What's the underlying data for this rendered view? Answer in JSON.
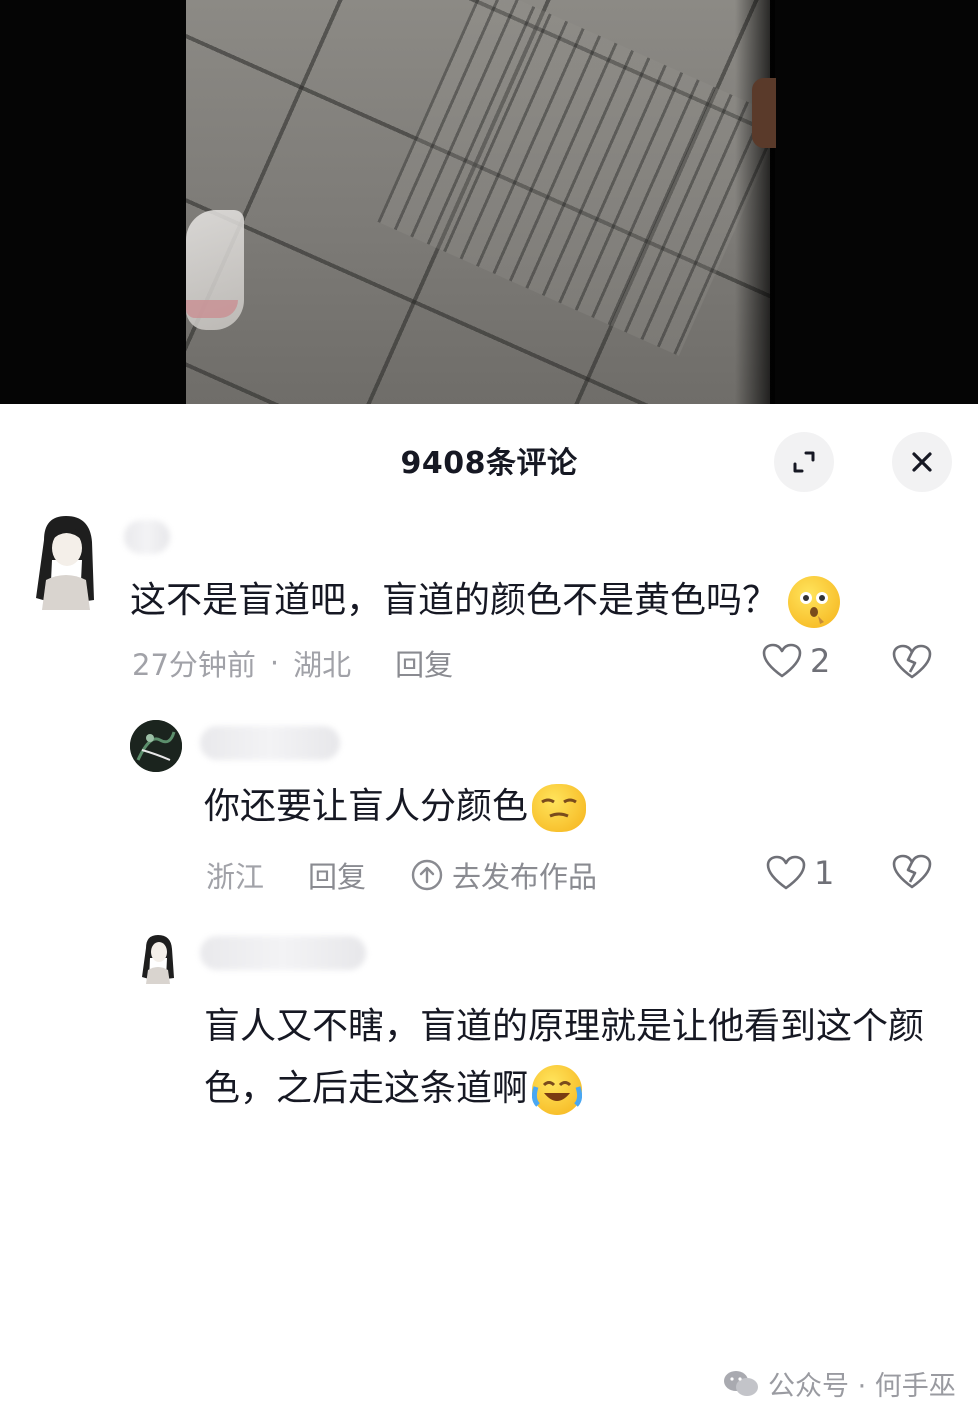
{
  "panel": {
    "title": "9408条评论"
  },
  "comments": [
    {
      "text": "这不是盲道吧，盲道的颜色不是黄色吗？",
      "time": "27分钟前",
      "dot": "·",
      "region": "湖北",
      "reply_label": "回复",
      "like_count": "2",
      "emoji": "thinking-emoji"
    },
    {
      "text": "你还要让盲人分颜色",
      "region": "浙江",
      "reply_label": "回复",
      "publish_label": "去发布作品",
      "like_count": "1",
      "emoji": "smug-emoji"
    },
    {
      "text": "盲人又不瞎，盲道的原理就是让他看到这个颜色，之后走这条道啊",
      "emoji": "laugh-cry-emoji"
    }
  ],
  "watermark": {
    "text": "公众号 · 何手巫"
  },
  "colors": {
    "primary_text": "#161823",
    "secondary_text": "#a1a2a8",
    "icon": "#6f7077"
  }
}
